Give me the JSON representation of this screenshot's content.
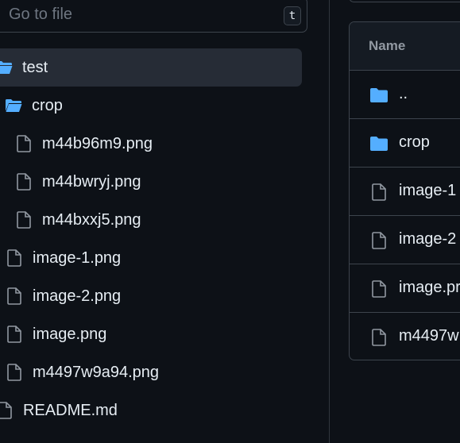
{
  "search": {
    "placeholder": "Go to file",
    "shortcut": "t"
  },
  "tree": {
    "items": [
      {
        "label": "test",
        "icon": "folder-open-icon"
      },
      {
        "label": "crop",
        "icon": "folder-open-icon"
      },
      {
        "label": "m44b96m9.png",
        "icon": "file-icon"
      },
      {
        "label": "m44bwryj.png",
        "icon": "file-icon"
      },
      {
        "label": "m44bxxj5.png",
        "icon": "file-icon"
      },
      {
        "label": "image-1.png",
        "icon": "file-icon"
      },
      {
        "label": "image-2.png",
        "icon": "file-icon"
      },
      {
        "label": "image.png",
        "icon": "file-icon"
      },
      {
        "label": "m4497w9a94.png",
        "icon": "file-icon"
      },
      {
        "label": "README.md",
        "icon": "file-icon"
      }
    ]
  },
  "table": {
    "header_name": "Name",
    "rows": [
      {
        "label": "..",
        "icon": "folder-icon"
      },
      {
        "label": "crop",
        "icon": "folder-icon"
      },
      {
        "label": "image-1",
        "icon": "file-icon"
      },
      {
        "label": "image-2",
        "icon": "file-icon"
      },
      {
        "label": "image.pr",
        "icon": "file-icon"
      },
      {
        "label": "m4497w",
        "icon": "file-icon"
      }
    ]
  },
  "colors": {
    "background": "#0d1117",
    "folder": "#54aeff",
    "selected_row": "#262c36",
    "border": "#3d444d",
    "text": "#e6edf3",
    "muted_text": "#9198a1"
  }
}
